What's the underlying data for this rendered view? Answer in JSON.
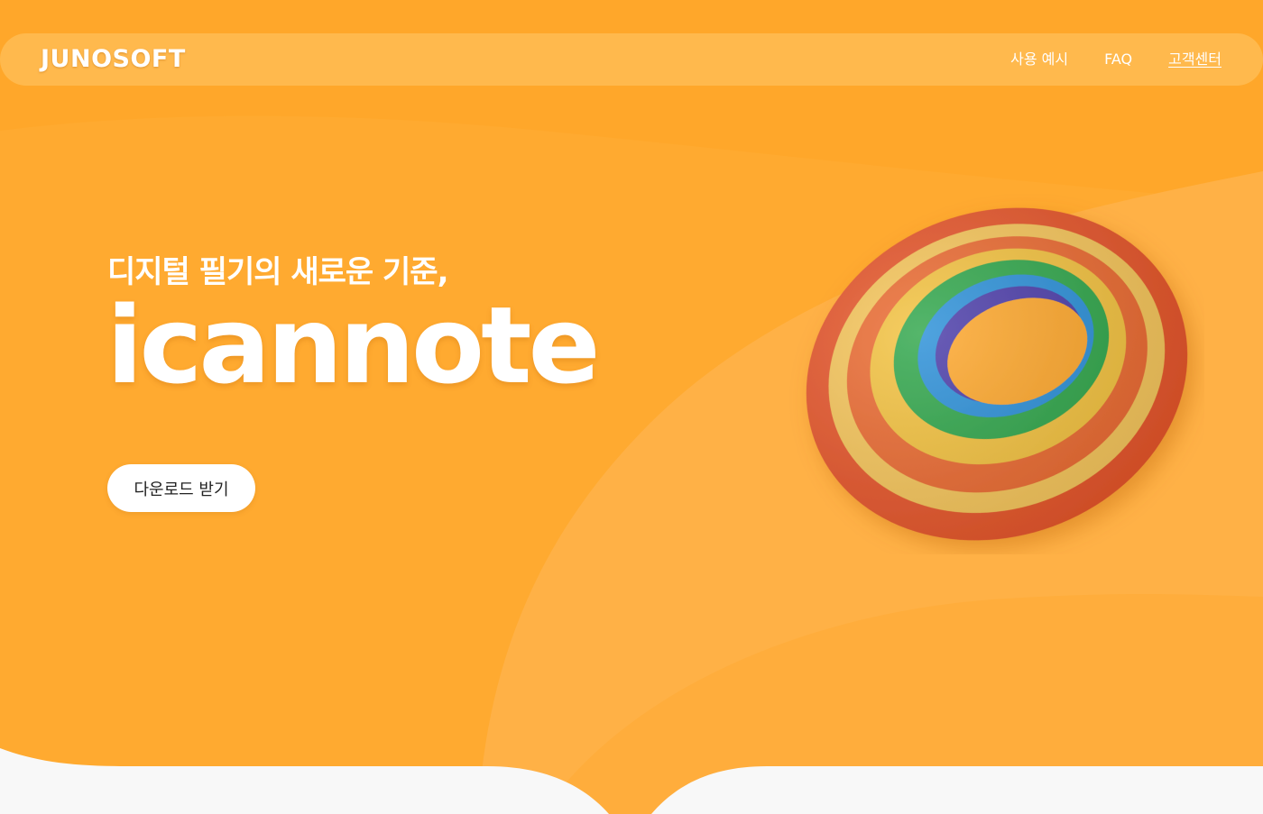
{
  "brand": {
    "logo_text": "JUNOSOFT"
  },
  "nav": {
    "items": [
      {
        "label": "사용 예시"
      },
      {
        "label": "FAQ"
      },
      {
        "label": "고객센터"
      }
    ]
  },
  "hero": {
    "subtitle": "디지털 필기의 새로운 기준,",
    "title": "icannote",
    "cta_label": "다운로드 받기"
  },
  "colors": {
    "background": "#FFA72A",
    "accent_light": "#FFB347",
    "white": "#FFFFFF",
    "footer_bg": "#F8F8F8"
  },
  "icons": {
    "hero_image": "rainbow-ring-image"
  }
}
